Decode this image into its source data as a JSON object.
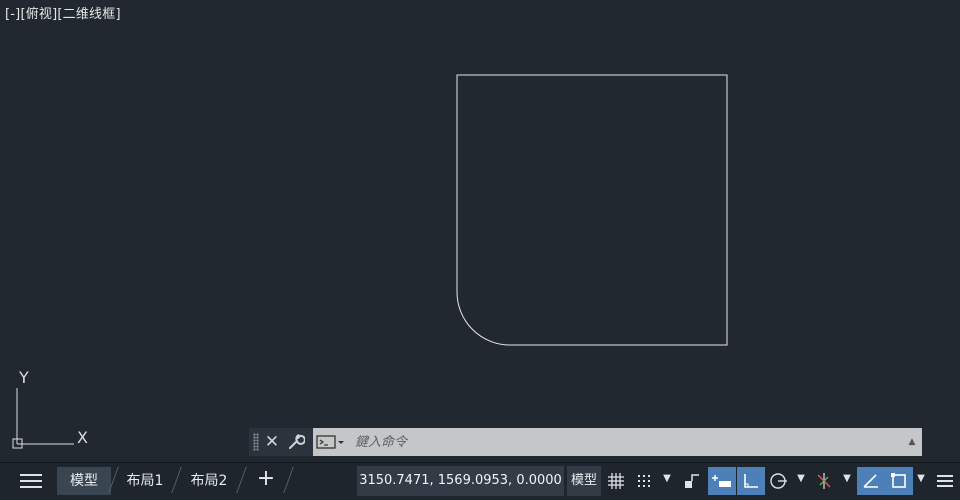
{
  "viewport": {
    "control": "[-]",
    "view": "[俯视]",
    "style": "[二维线框]"
  },
  "ucs": {
    "y_label": "Y",
    "x_label": "X"
  },
  "command_line": {
    "placeholder": "鍵入命令"
  },
  "status_bar": {
    "tabs": [
      {
        "label": "模型",
        "active": true
      },
      {
        "label": "布局1",
        "active": false
      },
      {
        "label": "布局2",
        "active": false
      }
    ],
    "add_tab": "+",
    "coordinates": "3150.7471, 1569.0953, 0.0000",
    "model_label": "模型"
  },
  "colors": {
    "background": "#212830",
    "geometry": "#e8e8e8",
    "active_toggle": "#4d7fb8"
  }
}
